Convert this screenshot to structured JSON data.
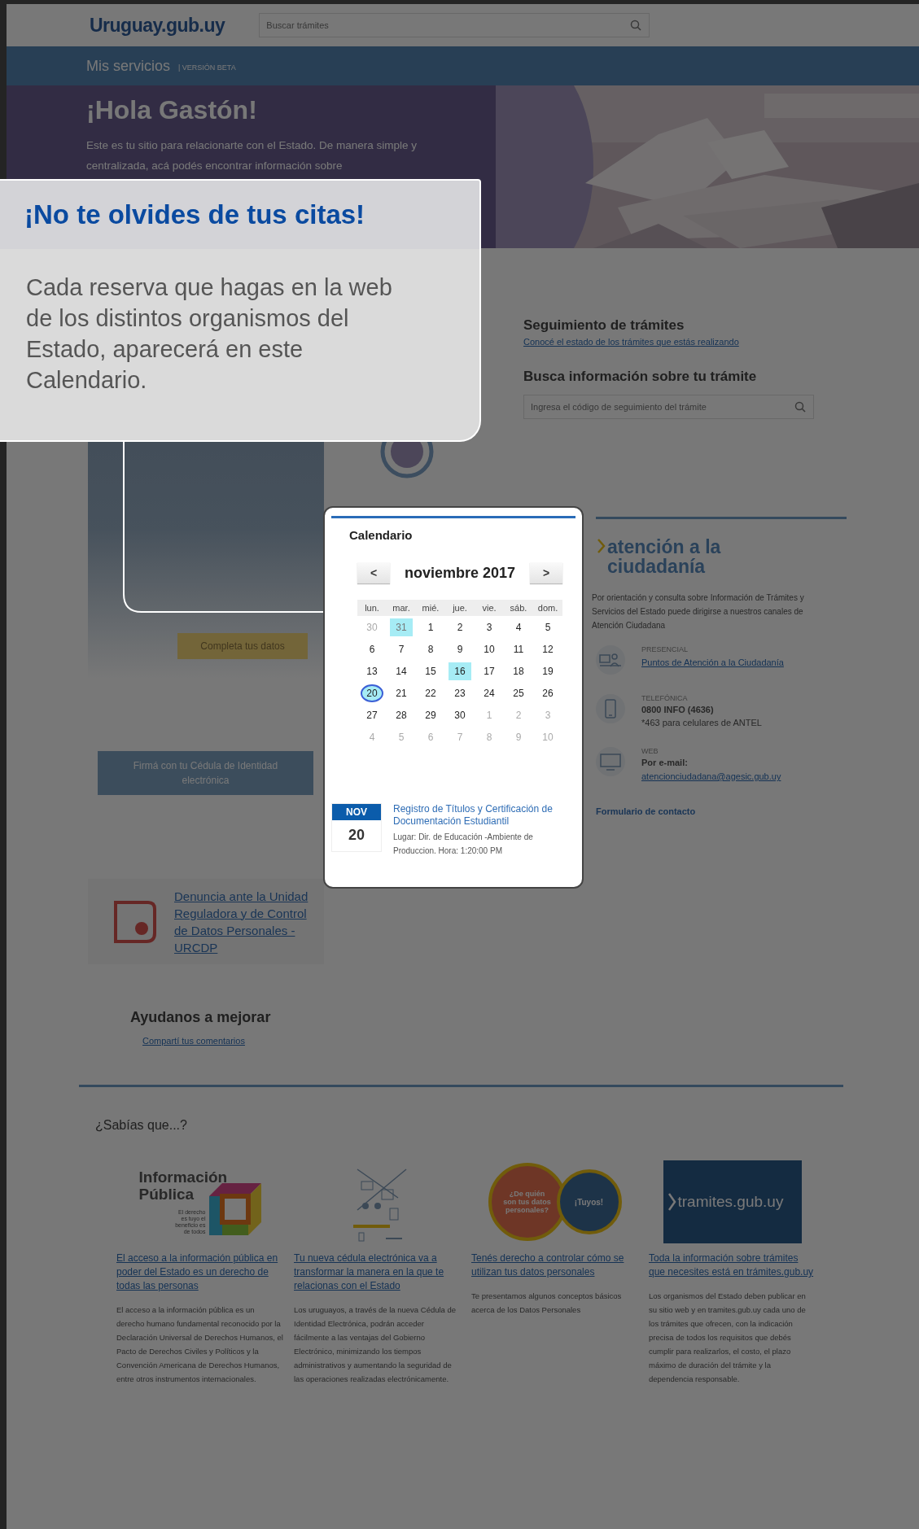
{
  "header": {
    "logo": "Uruguay.gub.uy",
    "search": {
      "placeholder": "Buscar trámites"
    }
  },
  "service_bar": {
    "title": "Mis servicios",
    "badge": "| VERSIÓN BETA"
  },
  "hero": {
    "title": "¡Hola Gastón!",
    "text": "Este es tu sitio para relacionarte con el Estado. De manera simple y centralizada, acá podés encontrar información sobre"
  },
  "profile_card": {
    "button": "Completa tus datos"
  },
  "tracking": {
    "title": "Seguimiento de trámites",
    "link": "Conocé el estado de los trámites que estás realizando",
    "search_title": "Busca información sobre tu trámite",
    "search": {
      "placeholder": "Ingresa el código de seguimiento del trámite"
    }
  },
  "attention": {
    "title": "atención a la ciudadanía",
    "text": "Por orientación y consulta sobre Información de Trámites y Servicios del Estado puede dirigirse a nuestros canales de Atención Ciudadana",
    "channels": [
      {
        "kind": "presencial",
        "label": "PRESENCIAL",
        "link": "Puntos de Atención a la Ciudadanía"
      },
      {
        "kind": "phone",
        "label": "TELEFÓNICA",
        "value": "0800 INFO (4636)",
        "note": "*463 para celulares de ANTEL"
      },
      {
        "kind": "web",
        "label": "WEB",
        "value": "Por e-mail:",
        "link": "atencionciudadana@agesic.gub.uy"
      }
    ],
    "contact_link": "Formulario de contacto"
  },
  "sign_button": "Firmá con tu Cédula de Identidad electrónica",
  "complaint": {
    "link": "Denuncia ante la Unidad Reguladora y de Control de Datos Personales - URCDP"
  },
  "feedback": {
    "title": "Ayudanos a mejorar",
    "link": "Compartí tus comentarios"
  },
  "did_you_know": {
    "title": "¿Sabías que...?",
    "items": [
      {
        "kind": "info-publica",
        "image_title": "Información Pública",
        "image_caption": "El derecho es tuyo el beneficio es de todos",
        "link": "El acceso a la información pública en poder del Estado es un derecho de todas las personas",
        "text": "El acceso a la información pública es un derecho humano fundamental reconocido por la Declaración Universal de Derechos Humanos, el Pacto de Derechos Civiles y Políticos y la Convención Americana de Derechos Humanos, entre otros instrumentos internacionales."
      },
      {
        "kind": "cedula",
        "link": "Tu nueva cédula electrónica va a transformar la manera en la que te relacionas con el Estado",
        "text": "Los uruguayos, a través de la nueva Cédula de Identidad Electrónica, podrán acceder fácilmente a las ventajas del Gobierno Electrónico, minimizando los tiempos administrativos y aumentando la seguridad de las operaciones realizadas electrónicamente."
      },
      {
        "kind": "datos",
        "image_title": "¿De quién son tus datos personales?",
        "image_caption": "¡Tuyos!",
        "link": "Tenés derecho a controlar cómo se utilizan tus datos personales",
        "text": "Te presentamos algunos conceptos básicos acerca de los Datos Personales"
      },
      {
        "kind": "tramites",
        "image_title": "tramites.gub.uy",
        "link": "Toda la información sobre trámites que necesites está en trámites.gub.uy",
        "text": "Los organismos del Estado deben publicar en su sitio web y en tramites.gub.uy cada uno de los trámites que ofrecen, con la indicación precisa de todos los requisitos que debés cumplir para realizarlos, el costo, el plazo máximo de duración del trámite y la dependencia responsable."
      }
    ]
  },
  "tooltip": {
    "title": "¡No te olvides de tus citas!",
    "text": "Cada reserva que hagas en la web de los distintos organismos del Estado, aparecerá en este Calendario."
  },
  "calendar": {
    "title": "Calendario",
    "prev": "<",
    "month": "noviembre 2017",
    "next": ">",
    "weekdays": [
      "lun.",
      "mar.",
      "mié.",
      "jue.",
      "vie.",
      "sáb.",
      "dom."
    ],
    "days": [
      {
        "label": "30",
        "muted": true,
        "highlighted": false,
        "today": false
      },
      {
        "label": "31",
        "muted": true,
        "highlighted": true,
        "today": false
      },
      {
        "label": "1",
        "muted": false,
        "highlighted": false,
        "today": false
      },
      {
        "label": "2",
        "muted": false,
        "highlighted": false,
        "today": false
      },
      {
        "label": "3",
        "muted": false,
        "highlighted": false,
        "today": false
      },
      {
        "label": "4",
        "muted": false,
        "highlighted": false,
        "today": false
      },
      {
        "label": "5",
        "muted": false,
        "highlighted": false,
        "today": false
      },
      {
        "label": "6",
        "muted": false,
        "highlighted": false,
        "today": false
      },
      {
        "label": "7",
        "muted": false,
        "highlighted": false,
        "today": false
      },
      {
        "label": "8",
        "muted": false,
        "highlighted": false,
        "today": false
      },
      {
        "label": "9",
        "muted": false,
        "highlighted": false,
        "today": false
      },
      {
        "label": "10",
        "muted": false,
        "highlighted": false,
        "today": false
      },
      {
        "label": "11",
        "muted": false,
        "highlighted": false,
        "today": false
      },
      {
        "label": "12",
        "muted": false,
        "highlighted": false,
        "today": false
      },
      {
        "label": "13",
        "muted": false,
        "highlighted": false,
        "today": false
      },
      {
        "label": "14",
        "muted": false,
        "highlighted": false,
        "today": false
      },
      {
        "label": "15",
        "muted": false,
        "highlighted": false,
        "today": false
      },
      {
        "label": "16",
        "muted": false,
        "highlighted": true,
        "today": false
      },
      {
        "label": "17",
        "muted": false,
        "highlighted": false,
        "today": false
      },
      {
        "label": "18",
        "muted": false,
        "highlighted": false,
        "today": false
      },
      {
        "label": "19",
        "muted": false,
        "highlighted": false,
        "today": false
      },
      {
        "label": "20",
        "muted": false,
        "highlighted": true,
        "today": true
      },
      {
        "label": "21",
        "muted": false,
        "highlighted": false,
        "today": false
      },
      {
        "label": "22",
        "muted": false,
        "highlighted": false,
        "today": false
      },
      {
        "label": "23",
        "muted": false,
        "highlighted": false,
        "today": false
      },
      {
        "label": "24",
        "muted": false,
        "highlighted": false,
        "today": false
      },
      {
        "label": "25",
        "muted": false,
        "highlighted": false,
        "today": false
      },
      {
        "label": "26",
        "muted": false,
        "highlighted": false,
        "today": false
      },
      {
        "label": "27",
        "muted": false,
        "highlighted": false,
        "today": false
      },
      {
        "label": "28",
        "muted": false,
        "highlighted": false,
        "today": false
      },
      {
        "label": "29",
        "muted": false,
        "highlighted": false,
        "today": false
      },
      {
        "label": "30",
        "muted": false,
        "highlighted": false,
        "today": false
      },
      {
        "label": "1",
        "muted": true,
        "highlighted": false,
        "today": false
      },
      {
        "label": "2",
        "muted": true,
        "highlighted": false,
        "today": false
      },
      {
        "label": "3",
        "muted": true,
        "highlighted": false,
        "today": false
      },
      {
        "label": "4",
        "muted": true,
        "highlighted": false,
        "today": false
      },
      {
        "label": "5",
        "muted": true,
        "highlighted": false,
        "today": false
      },
      {
        "label": "6",
        "muted": true,
        "highlighted": false,
        "today": false
      },
      {
        "label": "7",
        "muted": true,
        "highlighted": false,
        "today": false
      },
      {
        "label": "8",
        "muted": true,
        "highlighted": false,
        "today": false
      },
      {
        "label": "9",
        "muted": true,
        "highlighted": false,
        "today": false
      },
      {
        "label": "10",
        "muted": true,
        "highlighted": false,
        "today": false
      }
    ],
    "event": {
      "month": "NOV",
      "day": "20",
      "title": "Registro de Títulos y Certificación de Documentación Estudiantil",
      "detail": "Lugar: Dir. de Educación -Ambiente de Produccion. Hora: 1:20:00 PM"
    }
  }
}
